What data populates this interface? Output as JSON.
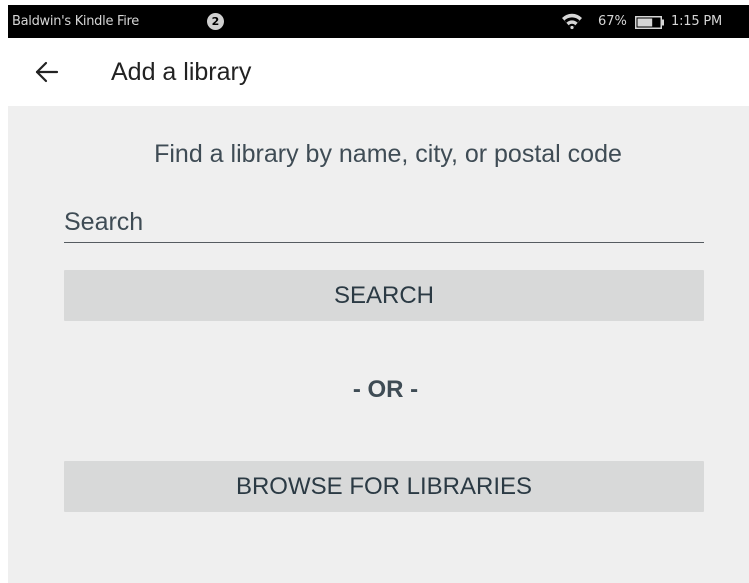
{
  "status_bar": {
    "device_name": "Baldwin's Kindle Fire",
    "notification_count": "2",
    "battery_percent": "67%",
    "battery_level": 0.67,
    "time": "1:15 PM",
    "icons": {
      "wifi": "wifi-icon",
      "battery": "battery-icon"
    }
  },
  "app_bar": {
    "back_icon": "back-arrow-icon",
    "title": "Add a library"
  },
  "main": {
    "prompt": "Find a library by name, city, or postal code",
    "search": {
      "placeholder": "Search",
      "value": ""
    },
    "search_button_label": "SEARCH",
    "or_label": "- OR -",
    "browse_button_label": "BROWSE FOR LIBRARIES"
  },
  "colors": {
    "content_background": "#efefef",
    "button_background": "#d8d9d9",
    "text": "#3f4c55",
    "status_bar": "#000000"
  }
}
